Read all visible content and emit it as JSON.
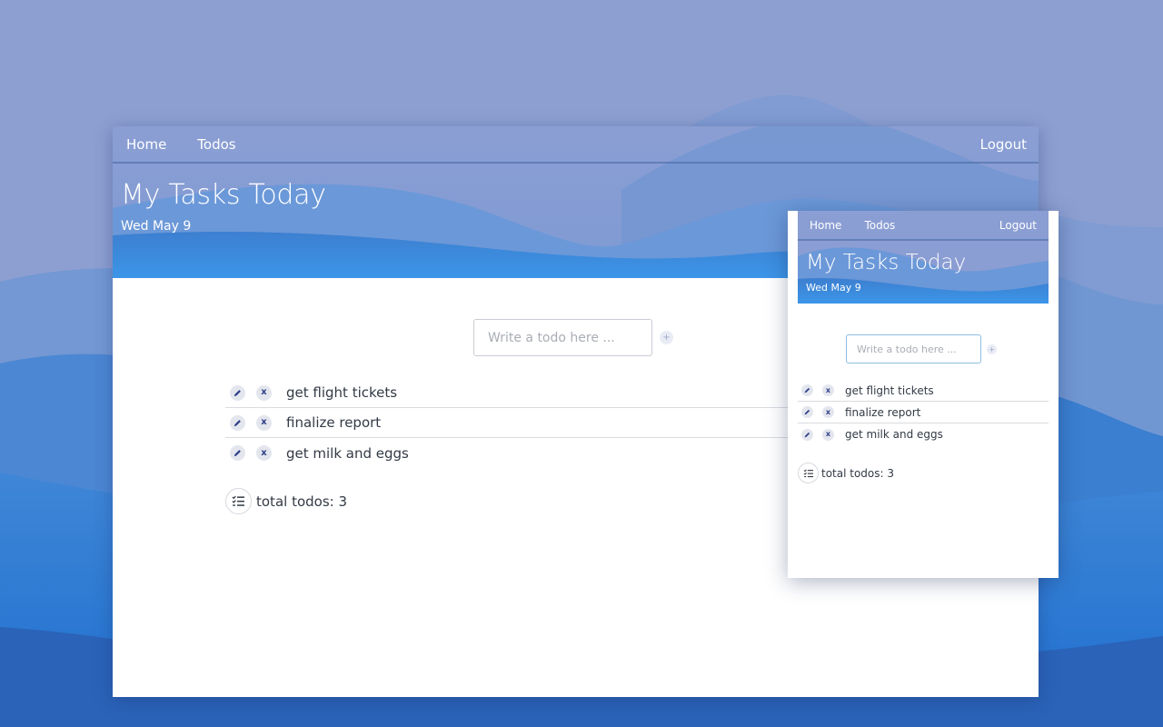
{
  "colors": {
    "background": "#8d9fd1",
    "wave_dark": "#2a63b8",
    "wave_mid": "#3d83d4",
    "accent_x": "#2d3f88"
  },
  "large_window": {
    "nav": {
      "home": "Home",
      "todos": "Todos",
      "logout": "Logout"
    },
    "title": "My Tasks Today",
    "date": "Wed May 9",
    "input_placeholder": "Write a todo here ...",
    "add_label": "+",
    "edit_icon": "pencil-icon",
    "delete_label": "x",
    "todos": [
      {
        "text": "get flight tickets"
      },
      {
        "text": "finalize report"
      },
      {
        "text": "get milk and eggs"
      }
    ],
    "total_icon": "checklist-icon",
    "total_text": "total todos: 3"
  },
  "small_window": {
    "nav": {
      "home": "Home",
      "todos": "Todos",
      "logout": "Logout"
    },
    "title": "My Tasks Today",
    "date": "Wed May 9",
    "input_placeholder": "Write a todo here ...",
    "add_label": "+",
    "edit_icon": "pencil-icon",
    "delete_label": "x",
    "todos": [
      {
        "text": "get flight tickets"
      },
      {
        "text": "finalize report"
      },
      {
        "text": "get milk and eggs"
      }
    ],
    "total_icon": "checklist-icon",
    "total_text": "total todos: 3"
  }
}
